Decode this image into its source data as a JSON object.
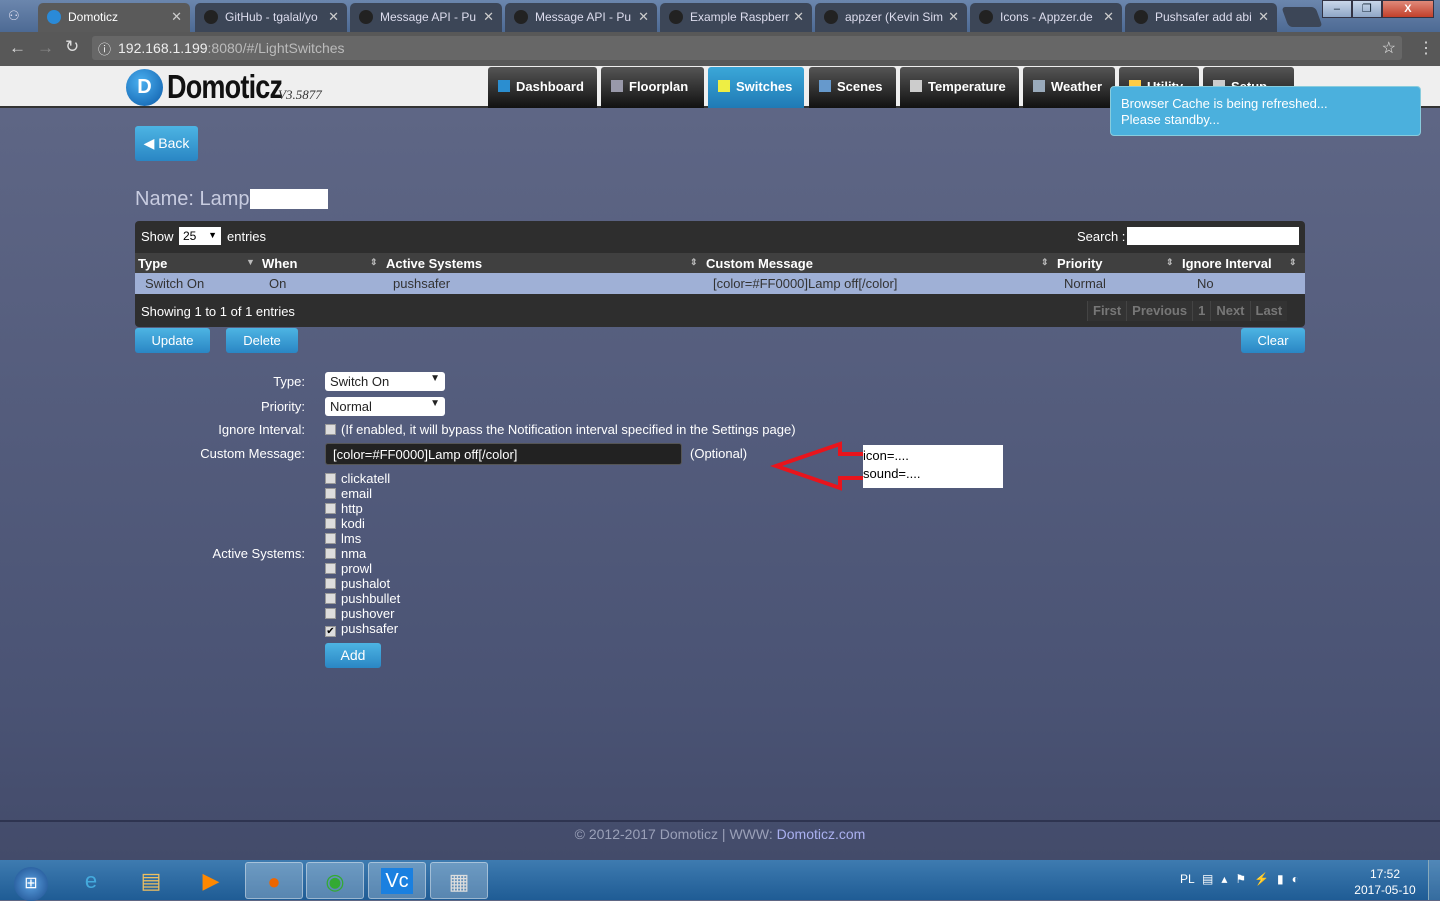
{
  "browser": {
    "tabs": [
      {
        "title": "Domoticz",
        "active": true
      },
      {
        "title": "GitHub - tgalal/yo"
      },
      {
        "title": "Message API - Pu"
      },
      {
        "title": "Message API - Pu"
      },
      {
        "title": "Example Raspberr"
      },
      {
        "title": "appzer (Kevin Sim"
      },
      {
        "title": "Icons - Appzer.de"
      },
      {
        "title": "Pushsafer add abi"
      }
    ],
    "url_host": "192.168.1.199",
    "url_rest": ":8080/#/LightSwitches"
  },
  "app": {
    "logo": "Domoticz",
    "version": "V3.5877",
    "nav": [
      {
        "label": "Dashboard"
      },
      {
        "label": "Floorplan"
      },
      {
        "label": "Switches",
        "selected": true
      },
      {
        "label": "Scenes"
      },
      {
        "label": "Temperature"
      },
      {
        "label": "Weather"
      },
      {
        "label": "Utility"
      },
      {
        "label": "Setup"
      }
    ],
    "toast": {
      "line1": "Browser Cache is being refreshed...",
      "line2": "Please standby..."
    },
    "back_label": "Back",
    "name_label": "Name: Lamp"
  },
  "table": {
    "show": "Show",
    "page_size": "25",
    "entries": "entries",
    "search_label": "Search :",
    "search_value": "",
    "columns": [
      "Type",
      "When",
      "Active Systems",
      "Custom Message",
      "Priority",
      "Ignore Interval"
    ],
    "rows": [
      [
        "Switch On",
        "On",
        "pushsafer",
        "[color=#FF0000]Lamp off[/color]",
        "Normal",
        "No"
      ]
    ],
    "info": "Showing 1 to 1 of 1 entries",
    "pagination": [
      "First",
      "Previous",
      "1",
      "Next",
      "Last"
    ]
  },
  "actions": {
    "update": "Update",
    "delete": "Delete",
    "clear": "Clear",
    "add": "Add"
  },
  "form": {
    "type_label": "Type:",
    "type_value": "Switch On",
    "priority_label": "Priority:",
    "priority_value": "Normal",
    "ignore_label": "Ignore Interval:",
    "ignore_text": "(If enabled, it will bypass the Notification interval specified in the Settings page)",
    "ignore_checked": false,
    "custom_label": "Custom Message:",
    "custom_value": "[color=#FF0000]Lamp off[/color]",
    "optional": "(Optional)",
    "systems_label": "Active Systems:",
    "systems": [
      {
        "name": "clickatell",
        "checked": false
      },
      {
        "name": "email",
        "checked": false
      },
      {
        "name": "http",
        "checked": false
      },
      {
        "name": "kodi",
        "checked": false
      },
      {
        "name": "lms",
        "checked": false
      },
      {
        "name": "nma",
        "checked": false
      },
      {
        "name": "prowl",
        "checked": false
      },
      {
        "name": "pushalot",
        "checked": false
      },
      {
        "name": "pushbullet",
        "checked": false
      },
      {
        "name": "pushover",
        "checked": false
      },
      {
        "name": "pushsafer",
        "checked": true
      }
    ]
  },
  "annotation": {
    "line1": "icon=....",
    "line2": "sound=....",
    "arrow_color": "#e8141c"
  },
  "footer": {
    "copyright": "© 2012-2017 Domoticz | WWW: ",
    "link": "Domoticz.com"
  },
  "taskbar": {
    "lang": "PL",
    "time": "17:52",
    "date": "2017-05-10"
  },
  "colors": {
    "accent": "#2a86c4",
    "row_highlight": "#9fb0d6",
    "background": "#4a5374"
  }
}
